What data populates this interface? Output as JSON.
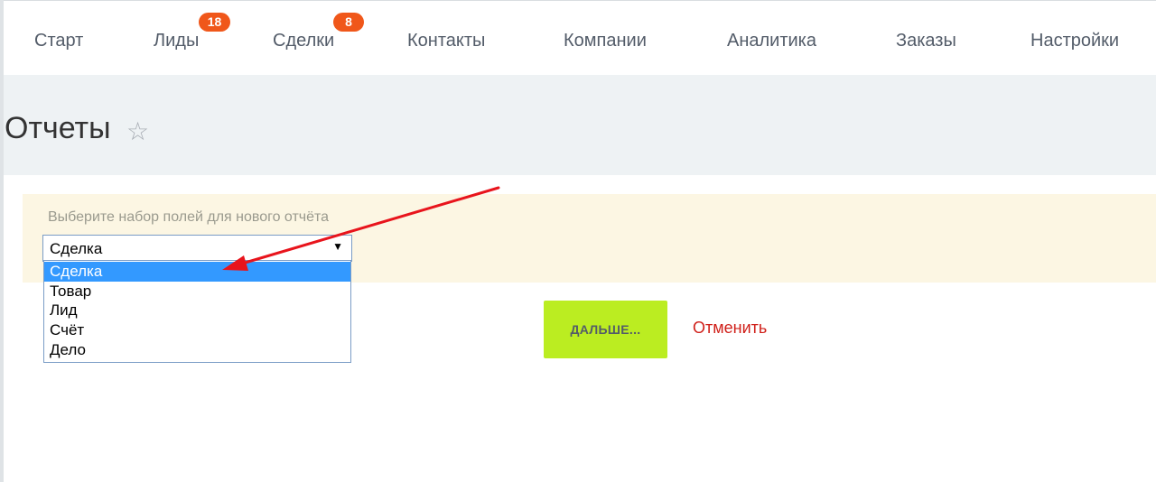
{
  "nav": {
    "items": [
      {
        "label": "Старт"
      },
      {
        "label": "Лиды",
        "badge": "18"
      },
      {
        "label": "Сделки",
        "badge": "8"
      },
      {
        "label": "Контакты"
      },
      {
        "label": "Компании"
      },
      {
        "label": "Аналитика"
      },
      {
        "label": "Заказы"
      },
      {
        "label": "Настройки"
      }
    ]
  },
  "page": {
    "title": "Отчеты"
  },
  "form": {
    "label": "Выберите набор полей для нового отчёта",
    "select_value": "Сделка",
    "options": [
      "Сделка",
      "Товар",
      "Лид",
      "Счёт",
      "Дело"
    ],
    "selected_index": 0,
    "next_button": "ДАЛЬШЕ...",
    "cancel_link": "Отменить"
  },
  "colors": {
    "badge": "#f0571a",
    "next_button": "#bbed21",
    "cancel": "#d0201a",
    "selected_option": "#3399ff",
    "annotation_arrow": "#e8141c"
  }
}
